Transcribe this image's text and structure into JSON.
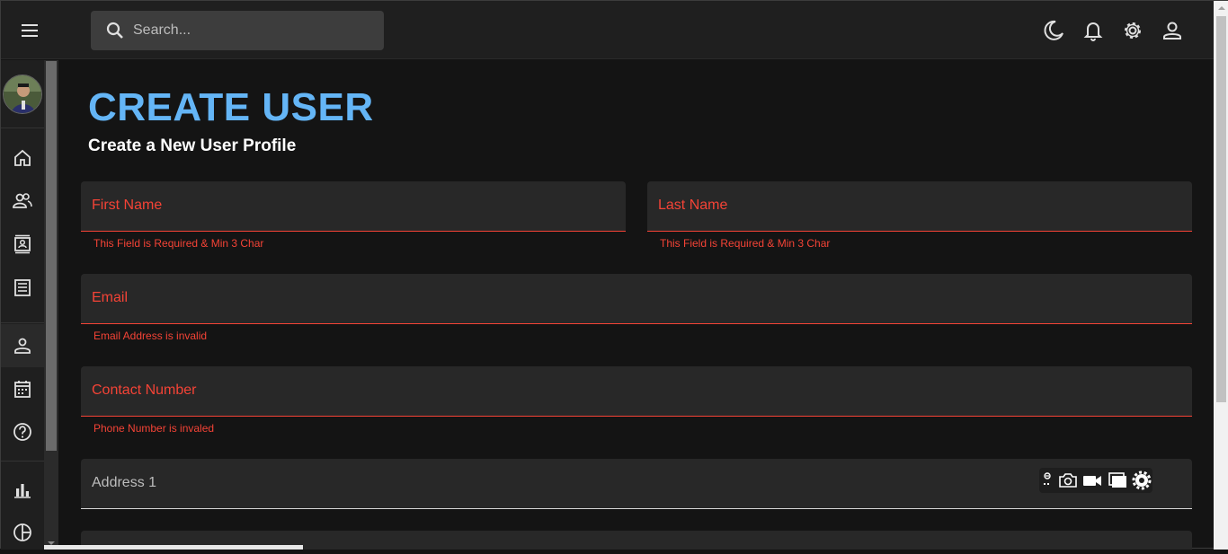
{
  "topbar": {
    "search_placeholder": "Search...",
    "icons": [
      "menu-icon",
      "search-icon",
      "dark-mode-icon",
      "notifications-icon",
      "settings-icon",
      "account-icon"
    ]
  },
  "sidebar": {
    "items": [
      {
        "name": "home-icon"
      },
      {
        "name": "team-icon"
      },
      {
        "name": "contacts-icon"
      },
      {
        "name": "invoices-icon"
      },
      {
        "name": "profile-form-icon",
        "active": true
      },
      {
        "name": "calendar-icon"
      },
      {
        "name": "faq-icon"
      },
      {
        "name": "bar-chart-icon"
      },
      {
        "name": "pie-chart-icon"
      }
    ]
  },
  "page": {
    "title": "CREATE USER",
    "subtitle": "Create a New User Profile"
  },
  "form": {
    "first_name": {
      "label": "First Name",
      "error": "This Field is Required & Min 3 Char"
    },
    "last_name": {
      "label": "Last Name",
      "error": "This Field is Required & Min 3 Char"
    },
    "email": {
      "label": "Email",
      "error": "Email Address is invalid"
    },
    "contact": {
      "label": "Contact Number",
      "error": "Phone Number is invaled"
    },
    "address1": {
      "label": "Address 1"
    }
  },
  "extension_tools": [
    "edit-icon",
    "camera-icon",
    "video-icon",
    "window-icon",
    "gear-icon"
  ],
  "colors": {
    "accent": "#64b5f6",
    "error": "#f44336",
    "background": "#141414",
    "surface": "#1f1f1f"
  }
}
